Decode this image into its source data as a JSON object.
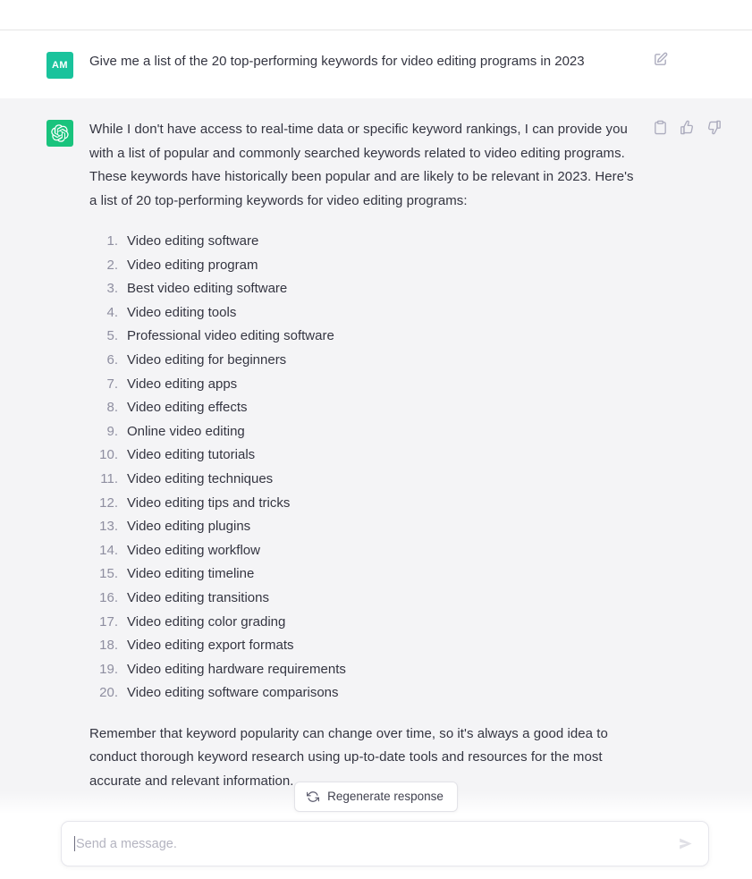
{
  "app": {
    "title": "ChatGPT conversation"
  },
  "user_message": {
    "avatar_initials": "AM",
    "avatar_color": "#19c39c",
    "text": "Give me a list of the 20 top-performing keywords for video editing programs in 2023",
    "edit_icon": "edit-square-icon"
  },
  "assistant_message": {
    "avatar_color": "#19c37d",
    "avatar_icon": "openai-logo-icon",
    "intro_paragraph": "While I don't have access to real-time data or specific keyword rankings, I can provide you with a list of popular and commonly searched keywords related to video editing programs. These keywords have historically been popular and are likely to be relevant in 2023. Here's a list of 20 top-performing keywords for video editing programs:",
    "keywords": [
      "Video editing software",
      "Video editing program",
      "Best video editing software",
      "Video editing tools",
      "Professional video editing software",
      "Video editing for beginners",
      "Video editing apps",
      "Video editing effects",
      "Online video editing",
      "Video editing tutorials",
      "Video editing techniques",
      "Video editing tips and tricks",
      "Video editing plugins",
      "Video editing workflow",
      "Video editing timeline",
      "Video editing transitions",
      "Video editing color grading",
      "Video editing export formats",
      "Video editing hardware requirements",
      "Video editing software comparisons"
    ],
    "closing_paragraph": "Remember that keyword popularity can change over time, so it's always a good idea to conduct thorough keyword research using up-to-date tools and resources for the most accurate and relevant information.",
    "actions": [
      {
        "name": "copy-icon",
        "label": "Copy"
      },
      {
        "name": "thumbs-up-icon",
        "label": "Good response"
      },
      {
        "name": "thumbs-down-icon",
        "label": "Bad response"
      }
    ]
  },
  "regenerate": {
    "label": "Regenerate response",
    "icon": "refresh-icon"
  },
  "composer": {
    "placeholder": "Send a message.",
    "value": "",
    "send_icon": "send-arrow-icon"
  },
  "colors": {
    "user_row_bg": "#ffffff",
    "assistant_row_bg": "#f4f4f6",
    "text": "#343541",
    "muted_text": "#8e8ea0",
    "accent_green": "#19c37d"
  }
}
